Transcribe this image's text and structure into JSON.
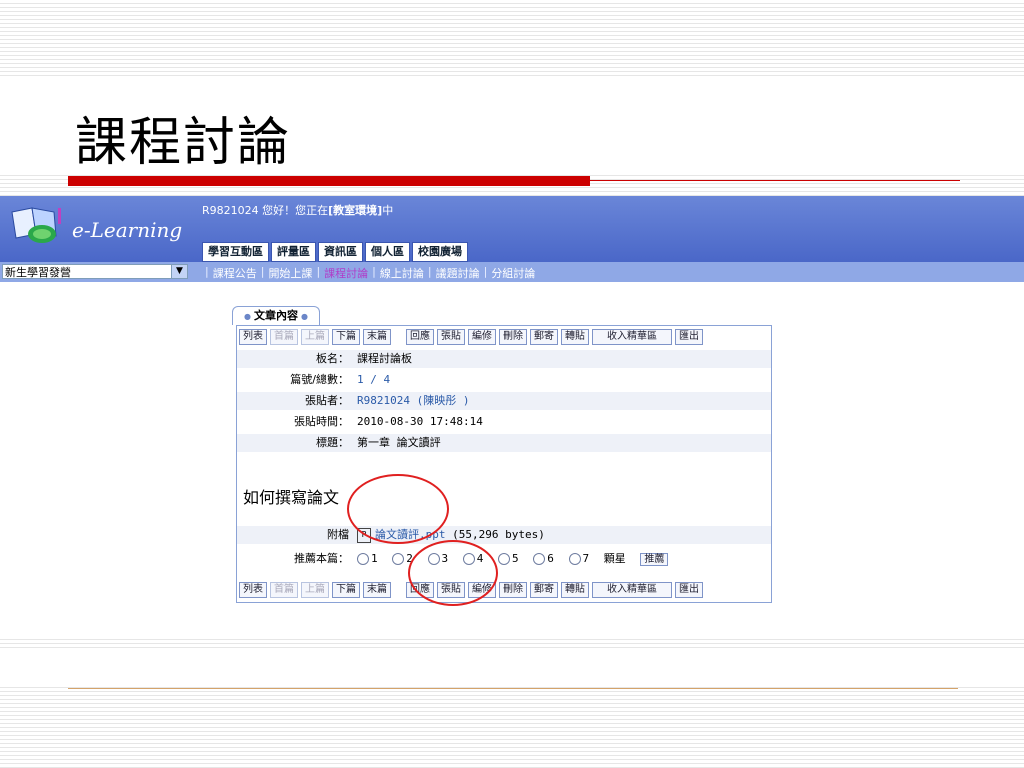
{
  "slide": {
    "title": "課程討論"
  },
  "app": {
    "logo_text": "e-Learning",
    "greeting_prefix": "R9821024 您好！您正在",
    "greeting_place": "[教室環境]",
    "greeting_suffix": "中",
    "main_tabs": [
      "學習互動區",
      "評量區",
      "資訊區",
      "個人區",
      "校園廣場"
    ],
    "course_select": "新生學習發營",
    "sub_links": [
      "課程公告",
      "開始上課",
      "課程討論",
      "線上討論",
      "議題討論",
      "分組討論"
    ]
  },
  "article": {
    "tab_label": "文章內容",
    "toolbar": [
      "列表",
      "首篇",
      "上篇",
      "下篇",
      "末篇",
      "回應",
      "張貼",
      "編修",
      "刪除",
      "郵寄",
      "轉貼",
      "收入精華區",
      "匯出"
    ],
    "fields": [
      {
        "label": "板名：",
        "value": "課程討論板"
      },
      {
        "label": "篇號/總數：",
        "value": "1 / 4"
      },
      {
        "label": "張貼者：",
        "value": "R9821024 (陳映彤 )"
      },
      {
        "label": "張貼時間：",
        "value": "2010-08-30 17:48:14"
      },
      {
        "label": "標題：",
        "value": "第一章 論文讀評"
      }
    ],
    "body": "如何撰寫論文",
    "attachment_label": "附檔",
    "attachment_name": "論文讀評.ppt",
    "attachment_size": "(55,296 bytes)",
    "recommend_label": "推薦本篇：",
    "ratings": [
      "1",
      "2",
      "3",
      "4",
      "5",
      "6",
      "7"
    ],
    "stars_label": "顆星",
    "recommend_button": "推薦"
  }
}
